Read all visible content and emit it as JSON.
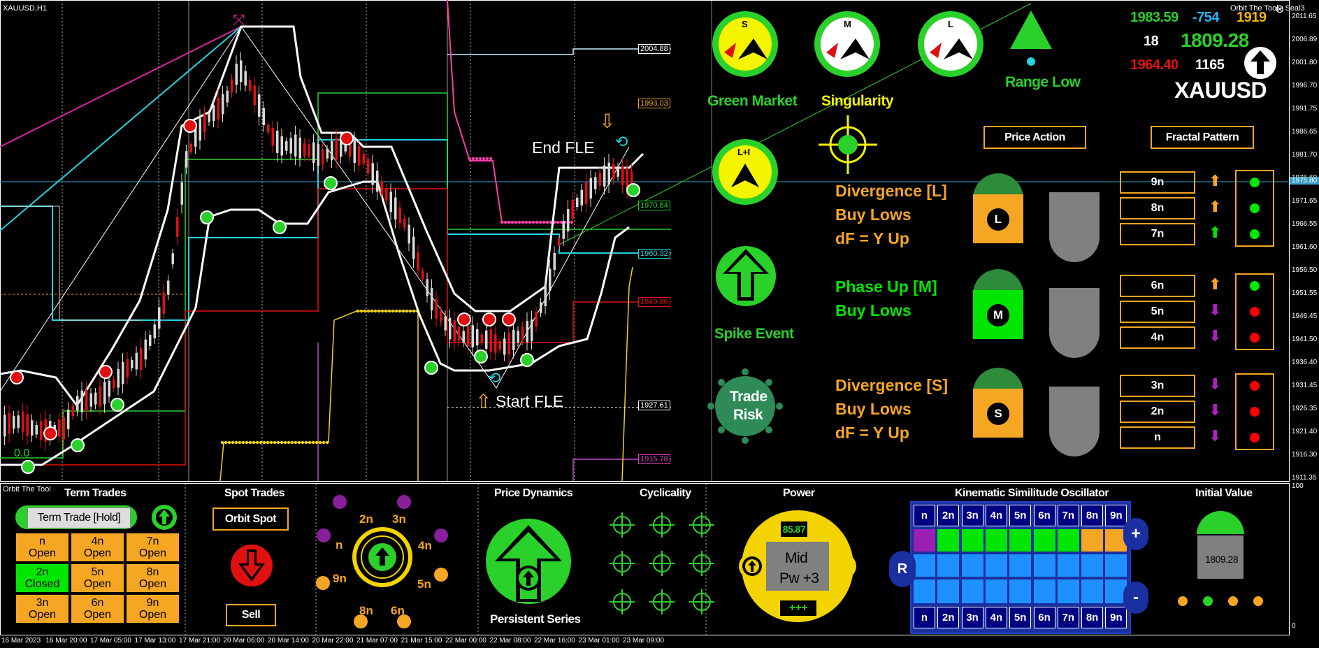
{
  "window": {
    "symbol_tf": "XAUUSD,H1",
    "indicator_short": "Orbit The Tool",
    "indicator_full": "Orbit The Tool - Seal3",
    "close_glyph": "⊗"
  },
  "price_axis": [
    "2011.65",
    "2006.89",
    "2001.80",
    "1996.70",
    "1991.75",
    "1986.65",
    "1981.70",
    "1976.60",
    "1971.65",
    "1966.55",
    "1961.60",
    "1956.50",
    "1951.55",
    "1946.45",
    "1941.50",
    "1936.40",
    "1931.45",
    "1926.35",
    "1921.40",
    "1916.30",
    "1911.35"
  ],
  "current_price_label": "1975.80",
  "oscillator_axis": {
    "top": "100",
    "bottom": "0"
  },
  "time_axis": [
    "16 Mar 2023",
    "16 Mar 20:00",
    "17 Mar 05:00",
    "17 Mar 13:00",
    "17 Mar 21:00",
    "20 Mar 06:00",
    "20 Mar 14:00",
    "20 Mar 22:00",
    "21 Mar 07:00",
    "21 Mar 15:00",
    "22 Mar 00:00",
    "22 Mar 08:00",
    "22 Mar 16:00",
    "23 Mar 01:00",
    "23 Mar 09:00"
  ],
  "level_labels": [
    "2004.88",
    "1993.03",
    "1970.84",
    "1960.32",
    "1949.80",
    "1927.61",
    "1915.78"
  ],
  "chart_annotations": {
    "end_fle": "End FLE",
    "start_fle": "Start FLE",
    "zero": "0.0"
  },
  "gauges": {
    "s": {
      "letter": "S",
      "label": "Green Market"
    },
    "m": {
      "letter": "M",
      "label": "Singularity"
    },
    "l": {
      "letter": "L",
      "label": ""
    },
    "l1": {
      "letter": "L+I"
    },
    "range": {
      "label": "Range Low"
    },
    "spike": {
      "label": "Spike Event"
    },
    "risk": {
      "label1": "Trade",
      "label2": "Risk"
    }
  },
  "info": {
    "v1": "1983.59",
    "v2": "-754",
    "v3": "1919",
    "v4": "18",
    "v5": "1809.28",
    "v6": "1964.40",
    "v7": "1165",
    "symbol": "XAUUSD"
  },
  "buttons": {
    "price_action": "Price Action",
    "fractal_pattern": "Fractal Pattern"
  },
  "signals": [
    {
      "lines": [
        "Divergence [L]",
        "Buy Lows",
        "dF = Y Up"
      ],
      "badge": "L",
      "color": "#f5a623"
    },
    {
      "lines": [
        "Phase Up [M]",
        "Buy Lows"
      ],
      "badge": "M",
      "color": "#00e600"
    },
    {
      "lines": [
        "Divergence [S]",
        "Buy Lows",
        "dF = Y Up"
      ],
      "badge": "S",
      "color": "#f5a623"
    }
  ],
  "cycles": [
    {
      "label": "9n",
      "arrow": "up",
      "arrow_color": "#f5a623",
      "dot": "#00e600"
    },
    {
      "label": "8n",
      "arrow": "up",
      "arrow_color": "#f5a623",
      "dot": "#00e600"
    },
    {
      "label": "7n",
      "arrow": "up",
      "arrow_color": "#00e600",
      "dot": "#00e600"
    },
    {
      "label": "6n",
      "arrow": "up",
      "arrow_color": "#f5a623",
      "dot": "#00e600"
    },
    {
      "label": "5n",
      "arrow": "down",
      "arrow_color": "#b020c0",
      "dot": "#ff0000"
    },
    {
      "label": "4n",
      "arrow": "down",
      "arrow_color": "#b020c0",
      "dot": "#ff0000"
    },
    {
      "label": "3n",
      "arrow": "down",
      "arrow_color": "#b020c0",
      "dot": "#ff0000"
    },
    {
      "label": "2n",
      "arrow": "down",
      "arrow_color": "#b020c0",
      "dot": "#ff0000"
    },
    {
      "label": "n",
      "arrow": "down",
      "arrow_color": "#b020c0",
      "dot": "#ff0000"
    }
  ],
  "term_trades": {
    "title": "Term Trades",
    "hold_button": "Term Trade [Hold]",
    "cells": [
      {
        "top": "n",
        "bottom": "Open",
        "state": "open"
      },
      {
        "top": "4n",
        "bottom": "Open",
        "state": "open"
      },
      {
        "top": "7n",
        "bottom": "Open",
        "state": "open"
      },
      {
        "top": "2n",
        "bottom": "Closed",
        "state": "closed"
      },
      {
        "top": "5n",
        "bottom": "Open",
        "state": "open"
      },
      {
        "top": "8n",
        "bottom": "Open",
        "state": "open"
      },
      {
        "top": "3n",
        "bottom": "Open",
        "state": "open"
      },
      {
        "top": "6n",
        "bottom": "Open",
        "state": "open"
      },
      {
        "top": "9n",
        "bottom": "Open",
        "state": "open"
      }
    ]
  },
  "spot_trades": {
    "title": "Spot Trades",
    "orbit_spot": "Orbit Spot",
    "sell": "Sell"
  },
  "orbit_ring": {
    "labels": [
      "2n",
      "3n",
      "4n",
      "5n",
      "6n",
      "8n",
      "9n",
      "n"
    ]
  },
  "price_dynamics": {
    "title": "Price Dynamics",
    "caption": "Persistent Series"
  },
  "cyclicality": {
    "title": "Cyclicality"
  },
  "power": {
    "title": "Power",
    "value": "85.87",
    "mid": "Mid",
    "pw": "Pw +3",
    "plus": "+++"
  },
  "kinematic": {
    "title": "Kinematic Similitude Oscillator",
    "headers": [
      "n",
      "2n",
      "3n",
      "4n",
      "5n",
      "6n",
      "7n",
      "8n",
      "9n"
    ],
    "row1": [
      "#9b1fb0",
      "#00e600",
      "#00e600",
      "#00e600",
      "#00e600",
      "#00e600",
      "#00e600",
      "#f5a623",
      "#f5a623"
    ],
    "r_label": "R",
    "plus": "+",
    "minus": "-"
  },
  "initial_value": {
    "title": "Initial Value",
    "value": "1809.28"
  }
}
